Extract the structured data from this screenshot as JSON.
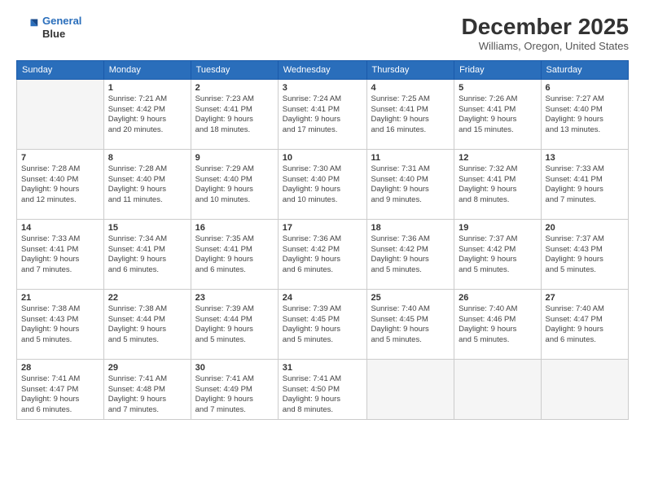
{
  "header": {
    "logo_line1": "General",
    "logo_line2": "Blue",
    "month": "December 2025",
    "location": "Williams, Oregon, United States"
  },
  "columns": [
    "Sunday",
    "Monday",
    "Tuesday",
    "Wednesday",
    "Thursday",
    "Friday",
    "Saturday"
  ],
  "weeks": [
    [
      {
        "day": "",
        "info": ""
      },
      {
        "day": "1",
        "info": "Sunrise: 7:21 AM\nSunset: 4:42 PM\nDaylight: 9 hours\nand 20 minutes."
      },
      {
        "day": "2",
        "info": "Sunrise: 7:23 AM\nSunset: 4:41 PM\nDaylight: 9 hours\nand 18 minutes."
      },
      {
        "day": "3",
        "info": "Sunrise: 7:24 AM\nSunset: 4:41 PM\nDaylight: 9 hours\nand 17 minutes."
      },
      {
        "day": "4",
        "info": "Sunrise: 7:25 AM\nSunset: 4:41 PM\nDaylight: 9 hours\nand 16 minutes."
      },
      {
        "day": "5",
        "info": "Sunrise: 7:26 AM\nSunset: 4:41 PM\nDaylight: 9 hours\nand 15 minutes."
      },
      {
        "day": "6",
        "info": "Sunrise: 7:27 AM\nSunset: 4:40 PM\nDaylight: 9 hours\nand 13 minutes."
      }
    ],
    [
      {
        "day": "7",
        "info": "Sunrise: 7:28 AM\nSunset: 4:40 PM\nDaylight: 9 hours\nand 12 minutes."
      },
      {
        "day": "8",
        "info": "Sunrise: 7:28 AM\nSunset: 4:40 PM\nDaylight: 9 hours\nand 11 minutes."
      },
      {
        "day": "9",
        "info": "Sunrise: 7:29 AM\nSunset: 4:40 PM\nDaylight: 9 hours\nand 10 minutes."
      },
      {
        "day": "10",
        "info": "Sunrise: 7:30 AM\nSunset: 4:40 PM\nDaylight: 9 hours\nand 10 minutes."
      },
      {
        "day": "11",
        "info": "Sunrise: 7:31 AM\nSunset: 4:40 PM\nDaylight: 9 hours\nand 9 minutes."
      },
      {
        "day": "12",
        "info": "Sunrise: 7:32 AM\nSunset: 4:41 PM\nDaylight: 9 hours\nand 8 minutes."
      },
      {
        "day": "13",
        "info": "Sunrise: 7:33 AM\nSunset: 4:41 PM\nDaylight: 9 hours\nand 7 minutes."
      }
    ],
    [
      {
        "day": "14",
        "info": "Sunrise: 7:33 AM\nSunset: 4:41 PM\nDaylight: 9 hours\nand 7 minutes."
      },
      {
        "day": "15",
        "info": "Sunrise: 7:34 AM\nSunset: 4:41 PM\nDaylight: 9 hours\nand 6 minutes."
      },
      {
        "day": "16",
        "info": "Sunrise: 7:35 AM\nSunset: 4:41 PM\nDaylight: 9 hours\nand 6 minutes."
      },
      {
        "day": "17",
        "info": "Sunrise: 7:36 AM\nSunset: 4:42 PM\nDaylight: 9 hours\nand 6 minutes."
      },
      {
        "day": "18",
        "info": "Sunrise: 7:36 AM\nSunset: 4:42 PM\nDaylight: 9 hours\nand 5 minutes."
      },
      {
        "day": "19",
        "info": "Sunrise: 7:37 AM\nSunset: 4:42 PM\nDaylight: 9 hours\nand 5 minutes."
      },
      {
        "day": "20",
        "info": "Sunrise: 7:37 AM\nSunset: 4:43 PM\nDaylight: 9 hours\nand 5 minutes."
      }
    ],
    [
      {
        "day": "21",
        "info": "Sunrise: 7:38 AM\nSunset: 4:43 PM\nDaylight: 9 hours\nand 5 minutes."
      },
      {
        "day": "22",
        "info": "Sunrise: 7:38 AM\nSunset: 4:44 PM\nDaylight: 9 hours\nand 5 minutes."
      },
      {
        "day": "23",
        "info": "Sunrise: 7:39 AM\nSunset: 4:44 PM\nDaylight: 9 hours\nand 5 minutes."
      },
      {
        "day": "24",
        "info": "Sunrise: 7:39 AM\nSunset: 4:45 PM\nDaylight: 9 hours\nand 5 minutes."
      },
      {
        "day": "25",
        "info": "Sunrise: 7:40 AM\nSunset: 4:45 PM\nDaylight: 9 hours\nand 5 minutes."
      },
      {
        "day": "26",
        "info": "Sunrise: 7:40 AM\nSunset: 4:46 PM\nDaylight: 9 hours\nand 5 minutes."
      },
      {
        "day": "27",
        "info": "Sunrise: 7:40 AM\nSunset: 4:47 PM\nDaylight: 9 hours\nand 6 minutes."
      }
    ],
    [
      {
        "day": "28",
        "info": "Sunrise: 7:41 AM\nSunset: 4:47 PM\nDaylight: 9 hours\nand 6 minutes."
      },
      {
        "day": "29",
        "info": "Sunrise: 7:41 AM\nSunset: 4:48 PM\nDaylight: 9 hours\nand 7 minutes."
      },
      {
        "day": "30",
        "info": "Sunrise: 7:41 AM\nSunset: 4:49 PM\nDaylight: 9 hours\nand 7 minutes."
      },
      {
        "day": "31",
        "info": "Sunrise: 7:41 AM\nSunset: 4:50 PM\nDaylight: 9 hours\nand 8 minutes."
      },
      {
        "day": "",
        "info": ""
      },
      {
        "day": "",
        "info": ""
      },
      {
        "day": "",
        "info": ""
      }
    ]
  ]
}
